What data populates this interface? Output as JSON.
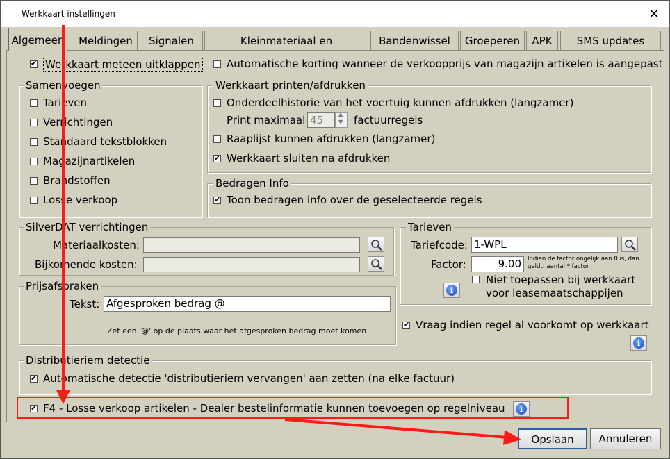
{
  "window": {
    "title": "Werkkaart instellingen",
    "close_glyph": "✕"
  },
  "tabs": [
    {
      "label": "Algemeen",
      "active": true
    },
    {
      "label": "Meldingen"
    },
    {
      "label": "Signalen"
    },
    {
      "label": "Kleinmateriaal en milieuheffing"
    },
    {
      "label": "Bandenwissel"
    },
    {
      "label": "Groeperen"
    },
    {
      "label": "APK"
    },
    {
      "label": "SMS updates"
    }
  ],
  "general": {
    "expand_label": "Werkkaart meteen uitklappen",
    "expand_checked": true,
    "auto_discount_label": "Automatische korting wanneer de verkoopprijs van magazijn artikelen is aangepast",
    "auto_discount_checked": false
  },
  "samenvoegen": {
    "legend": "Samenvoegen",
    "items": [
      {
        "label": "Tarieven",
        "checked": false
      },
      {
        "label": "Verrichtingen",
        "checked": false
      },
      {
        "label": "Standaard tekstblokken",
        "checked": false
      },
      {
        "label": "Magazijnartikelen",
        "checked": false
      },
      {
        "label": "Brandstoffen",
        "checked": false
      },
      {
        "label": "Losse verkoop",
        "checked": false
      }
    ]
  },
  "printen": {
    "legend": "Werkkaart printen/afdrukken",
    "history_label": "Onderdeelhistorie van het voertuig kunnen afdrukken (langzamer)",
    "history_checked": false,
    "print_max_prefix": "Print maximaal",
    "print_max_value": "45",
    "print_max_suffix": "factuurregels",
    "raaplijst_label": "Raaplijst kunnen afdrukken (langzamer)",
    "raaplijst_checked": false,
    "close_after_label": "Werkkaart sluiten na afdrukken",
    "close_after_checked": true
  },
  "bedragen": {
    "legend": "Bedragen Info",
    "show_label": "Toon bedragen info over de geselecteerde regels",
    "show_checked": true
  },
  "silverdat": {
    "legend": "SilverDAT verrichtingen",
    "material_label": "Materiaalkosten:",
    "material_value": "",
    "extra_label": "Bijkomende kosten:",
    "extra_value": ""
  },
  "tarieven": {
    "legend": "Tarieven",
    "code_label": "Tariefcode:",
    "code_value": "1-WPL",
    "factor_label": "Factor:",
    "factor_value": "9.00",
    "factor_note": "Indien de factor ongelijk aan 0 is, dan geldt: aantal * factor",
    "exclude_label_1": "Niet toepassen bij werkkaart",
    "exclude_label_2": "voor leasemaatschappijen",
    "exclude_checked": false
  },
  "prijsafspraken": {
    "legend": "Prijsafspraken",
    "text_label": "Tekst:",
    "text_value": "Afgesproken bedrag @",
    "hint": "Zet een '@' op de plaats waar het  afgesproken bedrag moet komen"
  },
  "vraag": {
    "label": "Vraag indien regel al voorkomt op werkkaart",
    "checked": true
  },
  "distributieriem": {
    "legend": "Distributieriem detectie",
    "auto_label": "Automatische detectie 'distributieriem vervangen' aan zetten (na elke factuur)",
    "auto_checked": true
  },
  "f4": {
    "label": "F4 - Losse verkoop artikelen - Dealer bestelinformatie kunnen toevoegen op regelniveau",
    "checked": true
  },
  "footer": {
    "save_label": "Opslaan",
    "cancel_label": "Annuleren"
  },
  "icons": {
    "info": "info-icon",
    "lookup": "magnifier-icon",
    "close": "close-icon"
  },
  "colors": {
    "annotation": "#ff1a1a",
    "info_blue": "#1646b8",
    "panel": "#d4d0c0"
  }
}
